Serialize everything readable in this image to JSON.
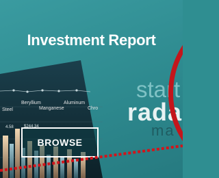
{
  "title": "Investment Report",
  "browse_label": "BROWSE",
  "side_words": {
    "w1": "start",
    "w2": "rada",
    "w3": "ma"
  },
  "photo_labels": {
    "steel": "Steel",
    "beryllium": "Beryllium",
    "aluminum": "Aluminum",
    "manganese": "Manganese",
    "chrome": "Chro",
    "price1": "4.58",
    "price2": "$244.34"
  },
  "colors": {
    "background": "#2f8e91",
    "accent_red": "#c3161c"
  }
}
